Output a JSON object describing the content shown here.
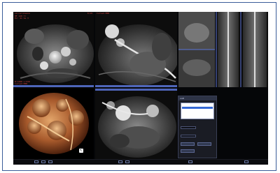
{
  "viewer": {
    "panes": [
      {
        "id": "axial-top-left",
        "overlay_top_left": "LU.Ceruleana\nHF 140 Yr\nEx: 21 Se 3\n",
        "overlay_top_right": "0/19",
        "overlay_bottom_left": "W:1400 L:530\nCurved MPR",
        "orientation": ""
      },
      {
        "id": "curved-mpr-top-center",
        "overlay_top_left": "Curved MPR",
        "overlay_top_right": "",
        "overlay_bottom_left": "",
        "orientation": ""
      },
      {
        "id": "vessel-straight-top-right",
        "overlay_top_left": "",
        "overlay_top_right": "",
        "overlay_bottom_left": "",
        "orientation": ""
      },
      {
        "id": "volume-render-bottom-left",
        "overlay_top_left": "",
        "overlay_top_right": "",
        "overlay_bottom_left": "",
        "orientation": "",
        "marker": "↖"
      },
      {
        "id": "axial-bottom-center",
        "overlay_top_left": "",
        "overlay_top_right": "",
        "overlay_bottom_left": "",
        "orientation": ""
      }
    ],
    "panel": {
      "title": "LAD",
      "items": [
        "",
        "",
        ""
      ],
      "selected_index": 1,
      "fields": [
        "",
        ""
      ],
      "buttons": [
        "",
        ""
      ]
    },
    "status_icons": [
      "save-icon",
      "print-icon",
      "grid-icon",
      "zoom-icon",
      "window-icon",
      "measure-icon",
      "export-icon"
    ]
  },
  "colors": {
    "frame_border": "#3b5d9a",
    "overlay_text": "#d04040",
    "scale_bar": "#5b75d8",
    "panel_highlight": "#3568d4"
  }
}
